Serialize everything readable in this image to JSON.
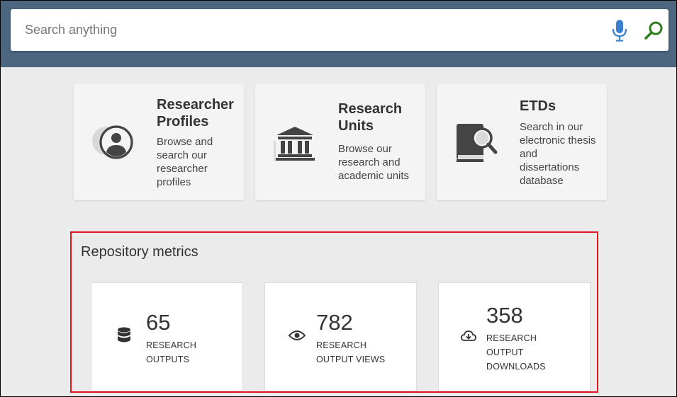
{
  "search": {
    "placeholder": "Search anything",
    "mic_icon": "microphone-icon",
    "search_icon": "magnifier-icon"
  },
  "colors": {
    "header_bg": "#4c6680",
    "mic_blue": "#3a7fd0",
    "search_green": "#2e7d1f",
    "highlight_red": "#e0141e"
  },
  "cards": [
    {
      "icon": "user-circle-icon",
      "title_line1": "Researcher",
      "title_line2": "Profiles",
      "desc_lines": [
        "Browse and",
        "search our",
        "researcher",
        "profiles"
      ]
    },
    {
      "icon": "institution-icon",
      "title_line1": "Research",
      "title_line2": "Units",
      "desc_lines": [
        "Browse our",
        "research and",
        "academic units"
      ]
    },
    {
      "icon": "book-search-icon",
      "title_line1": "ETDs",
      "desc_lines": [
        "Search in our",
        "electronic thesis",
        "and",
        "dissertations",
        "database"
      ]
    }
  ],
  "metrics": {
    "title": "Repository metrics",
    "items": [
      {
        "icon": "database-icon",
        "value": "65",
        "label_lines": [
          "RESEARCH",
          "OUTPUTS"
        ]
      },
      {
        "icon": "eye-icon",
        "value": "782",
        "label_lines": [
          "RESEARCH",
          "OUTPUT VIEWS"
        ]
      },
      {
        "icon": "cloud-download-icon",
        "value": "358",
        "label_lines": [
          "RESEARCH",
          "OUTPUT",
          "DOWNLOADS"
        ]
      }
    ]
  }
}
